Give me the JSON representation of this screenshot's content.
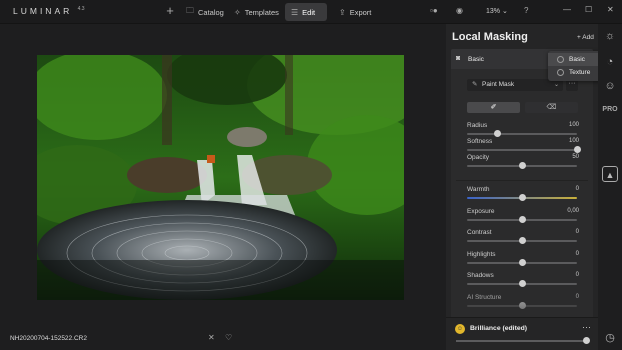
{
  "app": {
    "logo": "LUMINAR",
    "logo_version": "4.3"
  },
  "nav": {
    "catalog": "Catalog",
    "templates": "Templates",
    "edit": "Edit",
    "export": "Export"
  },
  "toolbar": {
    "zoom": "13%"
  },
  "file": {
    "name": "NH20200704-152522.CR2"
  },
  "panel": {
    "title": "Local Masking",
    "add_label": "+ Add",
    "tool_name": "Basic",
    "mask_type": "Paint Mask",
    "menu_more": "···"
  },
  "dropdown": {
    "items": [
      "Basic",
      "Texture"
    ]
  },
  "brush": {
    "radius": {
      "label": "Radius",
      "value": "100",
      "level": 0.28
    },
    "softness": {
      "label": "Softness",
      "value": "100",
      "level": 1.0
    },
    "opacity": {
      "label": "Opacity",
      "value": "50",
      "level": 0.5
    }
  },
  "adjust": [
    {
      "label": "Warmth",
      "value": "0",
      "level": 0.5,
      "warm": true
    },
    {
      "label": "Exposure",
      "value": "0,00",
      "level": 0.5
    },
    {
      "label": "Contrast",
      "value": "0",
      "level": 0.5
    },
    {
      "label": "Highlights",
      "value": "0",
      "level": 0.5
    },
    {
      "label": "Shadows",
      "value": "0",
      "level": 0.5
    },
    {
      "label": "AI Structure",
      "value": "0",
      "level": 0.5
    }
  ],
  "layer": {
    "name": "Brilliance (edited)",
    "level": 1.0
  }
}
